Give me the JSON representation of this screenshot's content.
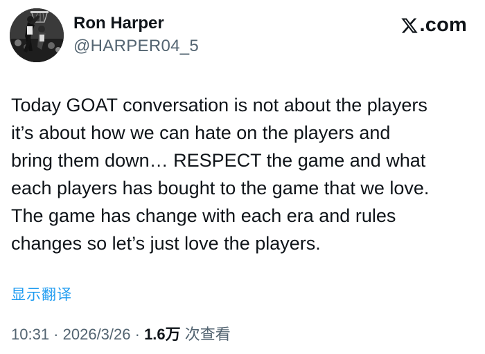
{
  "author": {
    "name": "Ron Harper",
    "handle": "@HARPER04_5",
    "avatar_icon": "basketball-photo-avatar"
  },
  "brand": {
    "label": ".com",
    "logo_icon": "x-logo-icon"
  },
  "tweet": {
    "lines": [
      "Today GOAT conversation is not about the players",
      "it’s about how we can hate on the players and",
      "bring them down… RESPECT the game and what",
      "each players has bought to the game that we love.",
      "The game has change with each era and rules",
      "changes so let’s just love the players."
    ]
  },
  "translate": {
    "label": "显示翻译"
  },
  "meta": {
    "time": "10:31",
    "sep1": " · ",
    "date": "2026/3/26",
    "sep2": " · ",
    "views_count": "1.6万",
    "views_label": " 次查看"
  },
  "colors": {
    "text": "#0f1419",
    "secondary": "#536471",
    "link": "#1d9bf0",
    "background": "#ffffff"
  }
}
